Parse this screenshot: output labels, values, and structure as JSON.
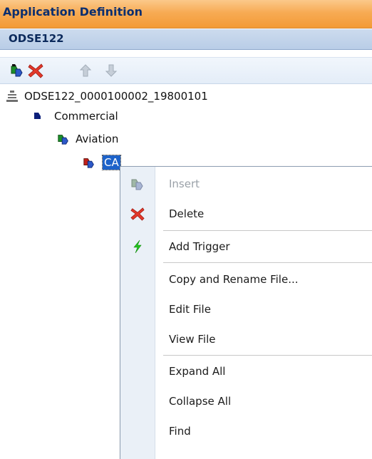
{
  "window": {
    "title": "Application Definition",
    "subtitle": "ODSE122"
  },
  "toolbar": {
    "buttons": [
      {
        "name": "insert",
        "icon": "insert-icon",
        "enabled": true
      },
      {
        "name": "delete",
        "icon": "delete-x-icon",
        "enabled": true
      },
      {
        "name": "move-up",
        "icon": "arrow-up-icon",
        "enabled": false
      },
      {
        "name": "move-down",
        "icon": "arrow-down-icon",
        "enabled": false
      }
    ]
  },
  "tree": {
    "root": {
      "label": "ODSE122_0000100002_19800101",
      "icon": "root-node-icon"
    },
    "level1": {
      "label": "Commercial",
      "icon": "folder-node-icon"
    },
    "level2": {
      "label": "Aviation",
      "icon": "green-node-icon"
    },
    "level3": {
      "label": "CA",
      "icon": "red-node-icon",
      "selected": true
    }
  },
  "context_menu": {
    "items": [
      {
        "label": "Insert",
        "icon": "insert-icon",
        "enabled": false
      },
      {
        "label": "Delete",
        "icon": "delete-x-icon",
        "enabled": true
      },
      {
        "label": "Add Trigger",
        "icon": "lightning-icon",
        "enabled": true
      },
      {
        "label": "Copy and Rename File...",
        "icon": "",
        "enabled": true
      },
      {
        "label": "Edit File",
        "icon": "",
        "enabled": true
      },
      {
        "label": "View File",
        "icon": "",
        "enabled": true
      },
      {
        "label": "Expand All",
        "icon": "",
        "enabled": true
      },
      {
        "label": "Collapse All",
        "icon": "",
        "enabled": true
      },
      {
        "label": "Find",
        "icon": "",
        "enabled": true
      }
    ]
  },
  "colors": {
    "title_bar": "#f7ab54",
    "title_text": "#0c2f6f",
    "subheader": "#bfd1e9",
    "selection": "#1d62c9",
    "delete_red": "#e2382a",
    "trigger_green": "#22c41d"
  }
}
